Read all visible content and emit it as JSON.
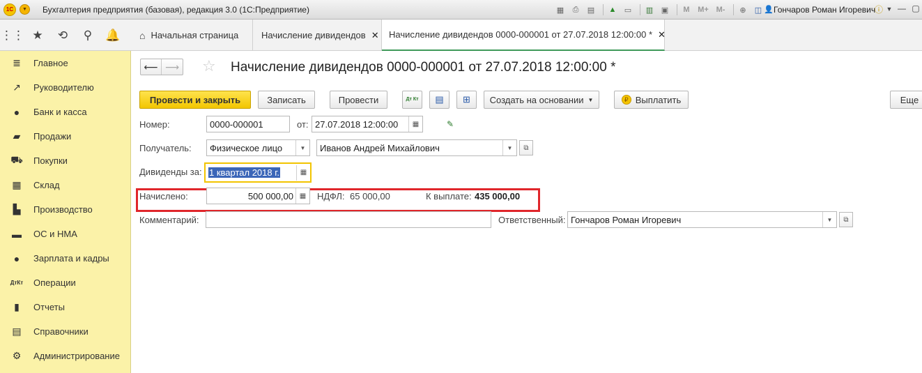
{
  "window": {
    "title": "Бухгалтерия предприятия (базовая), редакция 3.0  (1С:Предприятие)",
    "logo_text": "1С",
    "user": "Гончаров Роман Игоревич",
    "toolbar_letters": [
      "M",
      "M+",
      "M-"
    ]
  },
  "tabs": [
    {
      "label": "Начальная страница"
    },
    {
      "label": "Начисление дивидендов"
    },
    {
      "label": "Начисление дивидендов 0000-000001 от 27.07.2018 12:00:00 *"
    }
  ],
  "sidebar": {
    "items": [
      {
        "label": "Главное",
        "icon": "menu-icon"
      },
      {
        "label": "Руководителю",
        "icon": "trend-icon"
      },
      {
        "label": "Банк и касса",
        "icon": "ruble-icon"
      },
      {
        "label": "Продажи",
        "icon": "bag-icon"
      },
      {
        "label": "Покупки",
        "icon": "cart-icon"
      },
      {
        "label": "Склад",
        "icon": "grid-icon"
      },
      {
        "label": "Производство",
        "icon": "factory-icon"
      },
      {
        "label": "ОС и НМА",
        "icon": "car-icon"
      },
      {
        "label": "Зарплата и кадры",
        "icon": "person-icon"
      },
      {
        "label": "Операции",
        "icon": "dtkt-icon"
      },
      {
        "label": "Отчеты",
        "icon": "bar-chart-icon"
      },
      {
        "label": "Справочники",
        "icon": "book-icon"
      },
      {
        "label": "Администрирование",
        "icon": "gear-icon"
      }
    ]
  },
  "document": {
    "title": "Начисление дивидендов 0000-000001 от 27.07.2018 12:00:00 *",
    "buttons": {
      "post_close": "Провести и закрыть",
      "save": "Записать",
      "post": "Провести",
      "dtkt": "Дт Кт",
      "create_based": "Создать на основании",
      "pay": "Выплатить",
      "more": "Еще"
    },
    "fields": {
      "number_label": "Номер:",
      "number_value": "0000-000001",
      "date_label": "от:",
      "date_value": "27.07.2018 12:00:00",
      "recipient_label": "Получатель:",
      "recipient_type": "Физическое лицо",
      "recipient_name": "Иванов Андрей Михайлович",
      "period_label": "Дивиденды за:",
      "period_value": "1 квартал 2018 г.",
      "accrued_label": "Начислено:",
      "accrued_value": "500 000,00",
      "ndfl_label": "НДФЛ:",
      "ndfl_value": "65 000,00",
      "payout_label": "К выплате:",
      "payout_value": "435 000,00",
      "comment_label": "Комментарий:",
      "comment_value": "",
      "responsible_label": "Ответственный:",
      "responsible_value": "Гончаров Роман Игоревич"
    }
  }
}
